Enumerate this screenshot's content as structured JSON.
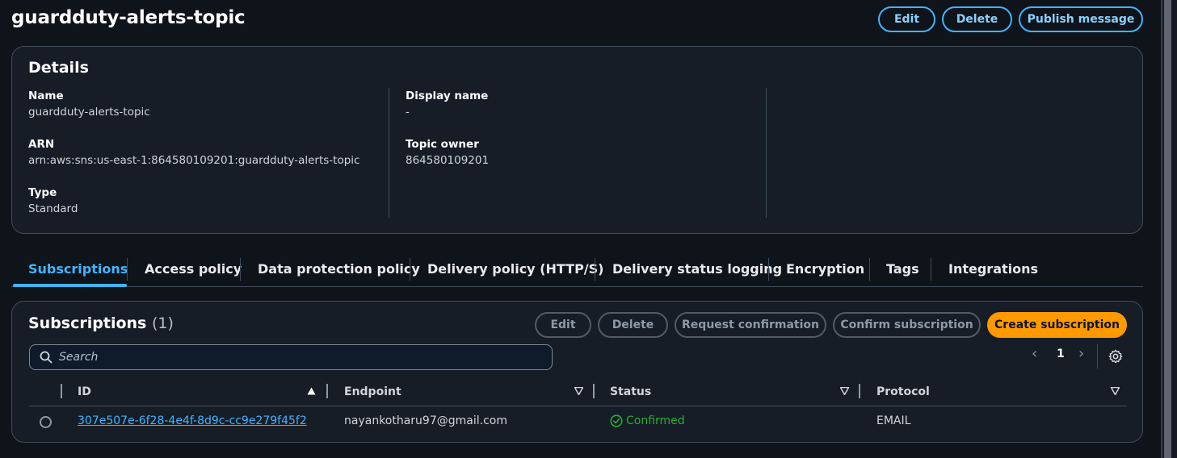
{
  "header": {
    "title": "guardduty-alerts-topic",
    "edit_label": "Edit",
    "delete_label": "Delete",
    "publish_label": "Publish message"
  },
  "details": {
    "heading": "Details",
    "name_label": "Name",
    "name_value": "guardduty-alerts-topic",
    "arn_label": "ARN",
    "arn_value": "arn:aws:sns:us-east-1:864580109201:guardduty-alerts-topic",
    "type_label": "Type",
    "type_value": "Standard",
    "display_name_label": "Display name",
    "display_name_value": "-",
    "topic_owner_label": "Topic owner",
    "topic_owner_value": "864580109201"
  },
  "tabs": [
    {
      "label": "Subscriptions",
      "active": true
    },
    {
      "label": "Access policy"
    },
    {
      "label": "Data protection policy"
    },
    {
      "label": "Delivery policy (HTTP/S)"
    },
    {
      "label": "Delivery status logging"
    },
    {
      "label": "Encryption"
    },
    {
      "label": "Tags"
    },
    {
      "label": "Integrations"
    }
  ],
  "subscriptions": {
    "heading": "Subscriptions",
    "count": "(1)",
    "edit_label": "Edit",
    "delete_label": "Delete",
    "request_confirmation_label": "Request confirmation",
    "confirm_subscription_label": "Confirm subscription",
    "create_subscription_label": "Create subscription",
    "search_placeholder": "Search",
    "page_prev": "‹",
    "page_number": "1",
    "page_next": "›",
    "columns": [
      "ID",
      "Endpoint",
      "Status",
      "Protocol"
    ],
    "rows": [
      {
        "id": "307e507e-6f28-4e4f-8d9c-cc9e279f45f2",
        "endpoint": "nayankotharu97@gmail.com",
        "status": "Confirmed",
        "protocol": "EMAIL"
      }
    ]
  },
  "colors": {
    "accent": "#42b4ff",
    "primary_button": "#ff9900",
    "success": "#29ad32",
    "background": "#0f141a"
  },
  "icons": {
    "search": "search-icon",
    "settings": "gear-icon",
    "status": "check-circle-icon",
    "sort_asc": "caret-up-icon",
    "sort_desc": "caret-down-icon"
  }
}
